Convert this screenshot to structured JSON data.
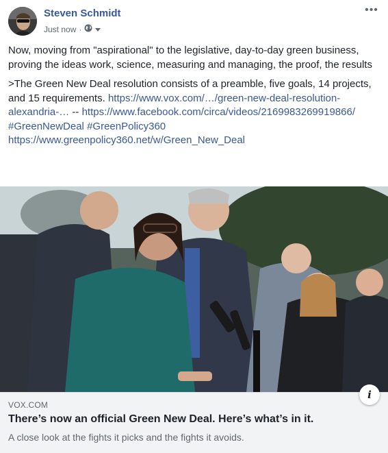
{
  "post": {
    "author": "Steven Schmidt",
    "timestamp": "Just now",
    "separator": "·",
    "privacy_icon": "globe-icon",
    "privacy_dropdown_icon": "caret-down-icon",
    "menu_icon": "more-horizontal-icon",
    "menu_glyph": "•••",
    "paragraph1": "Now, moving from \"aspirational\" to the legislative, day-to-day green business, proving the ideas work, science, measuring and managing, the proof, the results",
    "paragraph2_text": ">The Green New Deal resolution consists of a preamble, five goals, 14 projects, and 15 requirements.",
    "link1": "https://www.vox.com/…/green-new-deal-resolution-alexandria-…",
    "link_sep": "--",
    "link2": "https://www.facebook.com/circa/videos/2169983269919866/",
    "hashtag1": "#GreenNewDeal",
    "hashtag2": "#GreenPolicy360",
    "link3": "https://www.greenpolicy360.net/w/Green_New_Deal"
  },
  "link_card": {
    "domain": "VOX.COM",
    "headline": "There’s now an official Green New Deal. Here’s what’s in it.",
    "description": "A close look at the fights it picks and the fights it avoids.",
    "info_icon": "info-icon",
    "info_glyph": "i"
  },
  "colors": {
    "link": "#385898",
    "text": "#1d2129",
    "secondary": "#606770",
    "card_bg": "#f2f3f5"
  }
}
